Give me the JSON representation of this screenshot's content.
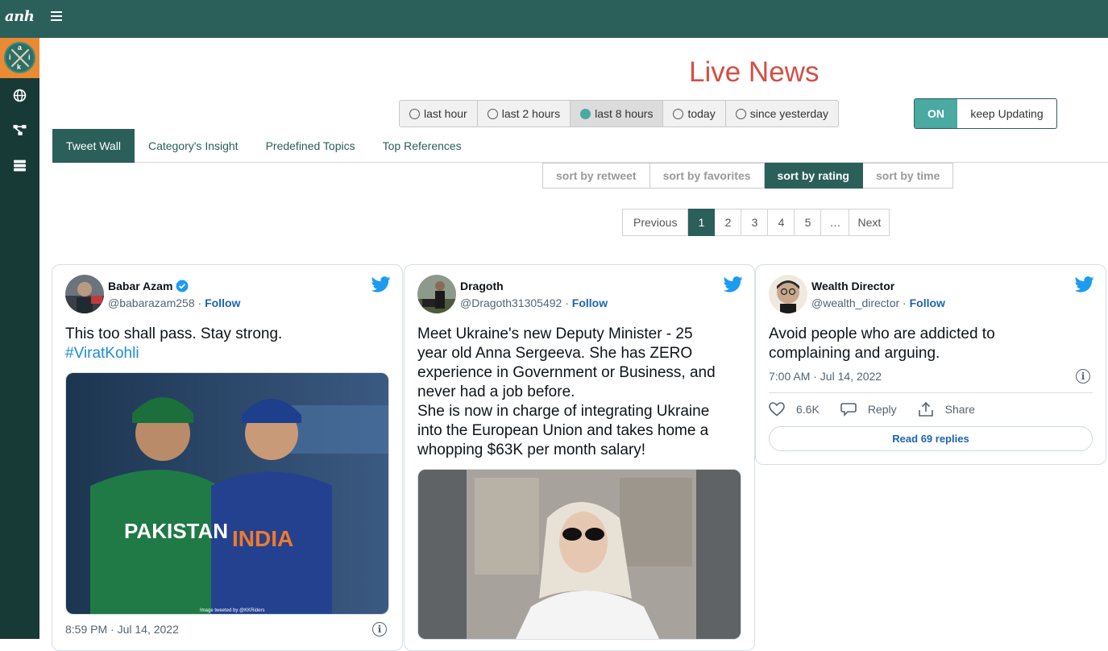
{
  "app": {
    "brand": "anh"
  },
  "logo": {
    "letters": [
      "a",
      "i",
      "i",
      "k"
    ]
  },
  "sidebar": {
    "items": [
      {
        "icon": "globe-icon"
      },
      {
        "icon": "network-icon"
      },
      {
        "icon": "server-icon"
      }
    ]
  },
  "header": {
    "title": "Live News"
  },
  "time_filters": {
    "options": [
      "last hour",
      "last 2 hours",
      "last 8 hours",
      "today",
      "since yesterday"
    ],
    "selected": "last 8 hours"
  },
  "updater": {
    "state": "ON",
    "label": "keep Updating"
  },
  "tabs": [
    "Tweet Wall",
    "Category's Insight",
    "Predefined Topics",
    "Top References"
  ],
  "active_tab": "Tweet Wall",
  "sort": {
    "options": [
      "sort by retweet",
      "sort by favorites",
      "sort by rating",
      "sort by time"
    ],
    "selected": "sort by rating"
  },
  "pagination": {
    "prev": "Previous",
    "pages": [
      "1",
      "2",
      "3",
      "4",
      "5",
      "…"
    ],
    "current": "1",
    "next": "Next"
  },
  "tweets": [
    {
      "name": "Babar Azam",
      "verified": true,
      "handle": "@babarazam258",
      "follow": "Follow",
      "text": "This too shall pass. Stay strong.",
      "hashtag": "#ViratKohli",
      "media_caption": "Image tweeted by @KKRiders",
      "jersey_left": "PAKISTAN",
      "jersey_right": "INDIA",
      "time": "8:59 PM · Jul 14, 2022"
    },
    {
      "name": "Dragoth",
      "verified": false,
      "handle": "@Dragoth31305492",
      "follow": "Follow",
      "text_lines": [
        "Meet Ukraine's new Deputy Minister - 25",
        "year old Anna Sergeeva. She has ZERO",
        "experience in Government or Business, and",
        "never had a job before.",
        "She is now in charge of integrating Ukraine",
        "into the European Union and takes home a",
        "whopping $63K per month salary!"
      ]
    },
    {
      "name": "Wealth Director",
      "verified": false,
      "handle": "@wealth_director",
      "follow": "Follow",
      "text_lines": [
        "Avoid people who are addicted to",
        "complaining and arguing."
      ],
      "time": "7:00 AM · Jul 14, 2022",
      "likes": "6.6K",
      "reply": "Reply",
      "share": "Share",
      "read_replies": "Read 69 replies"
    }
  ],
  "colors": {
    "primary": "#2b5f5a",
    "accent": "#4aa9a0",
    "title": "#d34f45",
    "link": "#1d64b0",
    "twitter": "#1d9bf0"
  }
}
